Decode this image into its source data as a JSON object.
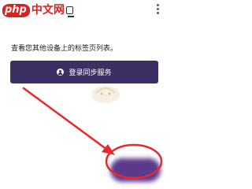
{
  "header": {
    "logo_text": "中文网",
    "logo_badge": "php",
    "tab_icon": "tabs-icon",
    "menu_icon": "more-vertical-icon"
  },
  "card": {
    "description": "查看您其他设备上的标签页列表。",
    "sync_button_label": "登录同步服务",
    "sync_button_icon": "account-icon"
  },
  "colors": {
    "brand_red": "#d9211f",
    "button_purple": "#3b2f63",
    "annotation_red": "#e8282b",
    "fab_purple": "#5b3a8c"
  },
  "fab": {
    "icon": "fab-button"
  }
}
